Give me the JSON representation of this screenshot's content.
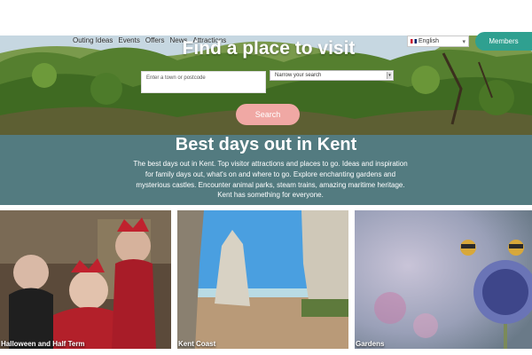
{
  "nav": {
    "items": [
      "Outing Ideas",
      "Events",
      "Offers",
      "News",
      "Attractions"
    ]
  },
  "language": {
    "selected": "English",
    "icon": "uk-flag-icon"
  },
  "members_label": "Members",
  "hero": {
    "title": "Find a place to visit",
    "town_placeholder": "Enter a town or postcode",
    "narrow_label": "Narrow your search",
    "search_label": "Search"
  },
  "intro": {
    "title": "Best days out in Kent",
    "text": "The best days out in Kent. Top visitor attractions and places to go. Ideas and inspiration for family days out, what's on and where to go. Explore enchanting gardens and mysterious castles. Encounter animal parks, steam trains, amazing maritime heritage. Kent has something for everyone."
  },
  "cards": [
    {
      "label": "Halloween and Half Term"
    },
    {
      "label": "Kent Coast"
    },
    {
      "label": "Gardens"
    }
  ],
  "colors": {
    "members": "#2fa090",
    "search": "#f0a8a4",
    "band": "#537b80"
  }
}
